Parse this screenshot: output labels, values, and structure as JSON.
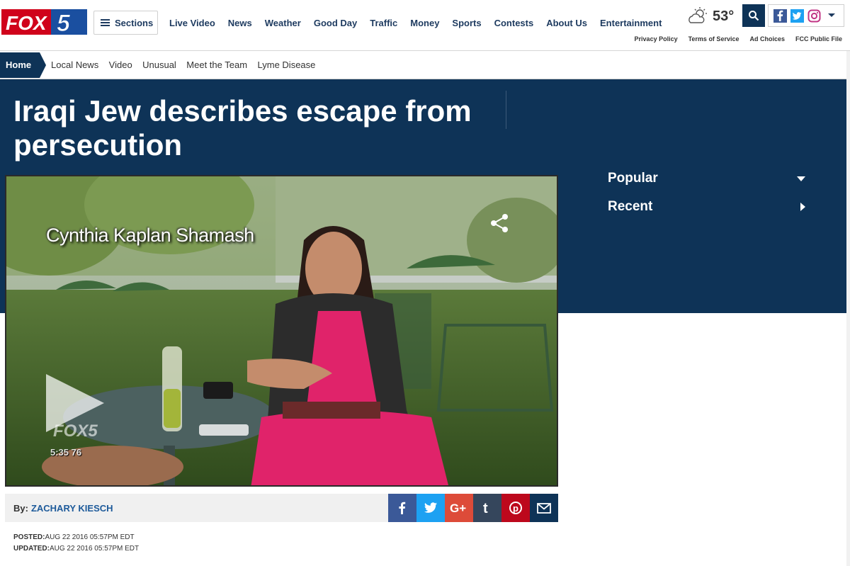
{
  "header": {
    "logo_text": "FOX",
    "logo_number": "5",
    "sections_label": "Sections",
    "nav": [
      "Live Video",
      "News",
      "Weather",
      "Good Day",
      "Traffic",
      "Money",
      "Sports",
      "Contests",
      "About Us",
      "Entertainment"
    ],
    "weather_temp": "53°",
    "weather_icon": "partly-cloudy-icon",
    "legal_links": [
      "Privacy Policy",
      "Terms of Service",
      "Ad Choices",
      "FCC Public File"
    ]
  },
  "breadcrumb": {
    "home": "Home",
    "links": [
      "Local News",
      "Video",
      "Unusual",
      "Meet the Team",
      "Lyme Disease"
    ]
  },
  "article": {
    "headline": "Iraqi Jew describes escape from persecution",
    "video": {
      "lower_third": "Cynthia Kaplan Shamash",
      "bug_logo": "FOX5",
      "bug_time": "5:35 76"
    },
    "byline_prefix": "By:",
    "author": "ZACHARY KIESCH",
    "posted_label": "POSTED:",
    "posted": "AUG 22 2016 05:57PM EDT",
    "updated_label": "UPDATED:",
    "updated": "AUG 22 2016 05:57PM EDT"
  },
  "sidebar": {
    "popular": "Popular",
    "recent": "Recent"
  },
  "share_buttons": [
    {
      "name": "facebook",
      "color": "#3b5998"
    },
    {
      "name": "twitter",
      "color": "#1da1f2"
    },
    {
      "name": "google-plus",
      "color": "#dd4b39"
    },
    {
      "name": "tumblr",
      "color": "#35465c"
    },
    {
      "name": "pinterest",
      "color": "#bd081c"
    },
    {
      "name": "email",
      "color": "#0e3357"
    }
  ],
  "colors": {
    "brand_navy": "#0e3357",
    "logo_red": "#d0021b",
    "logo_blue": "#1a4fa0"
  }
}
